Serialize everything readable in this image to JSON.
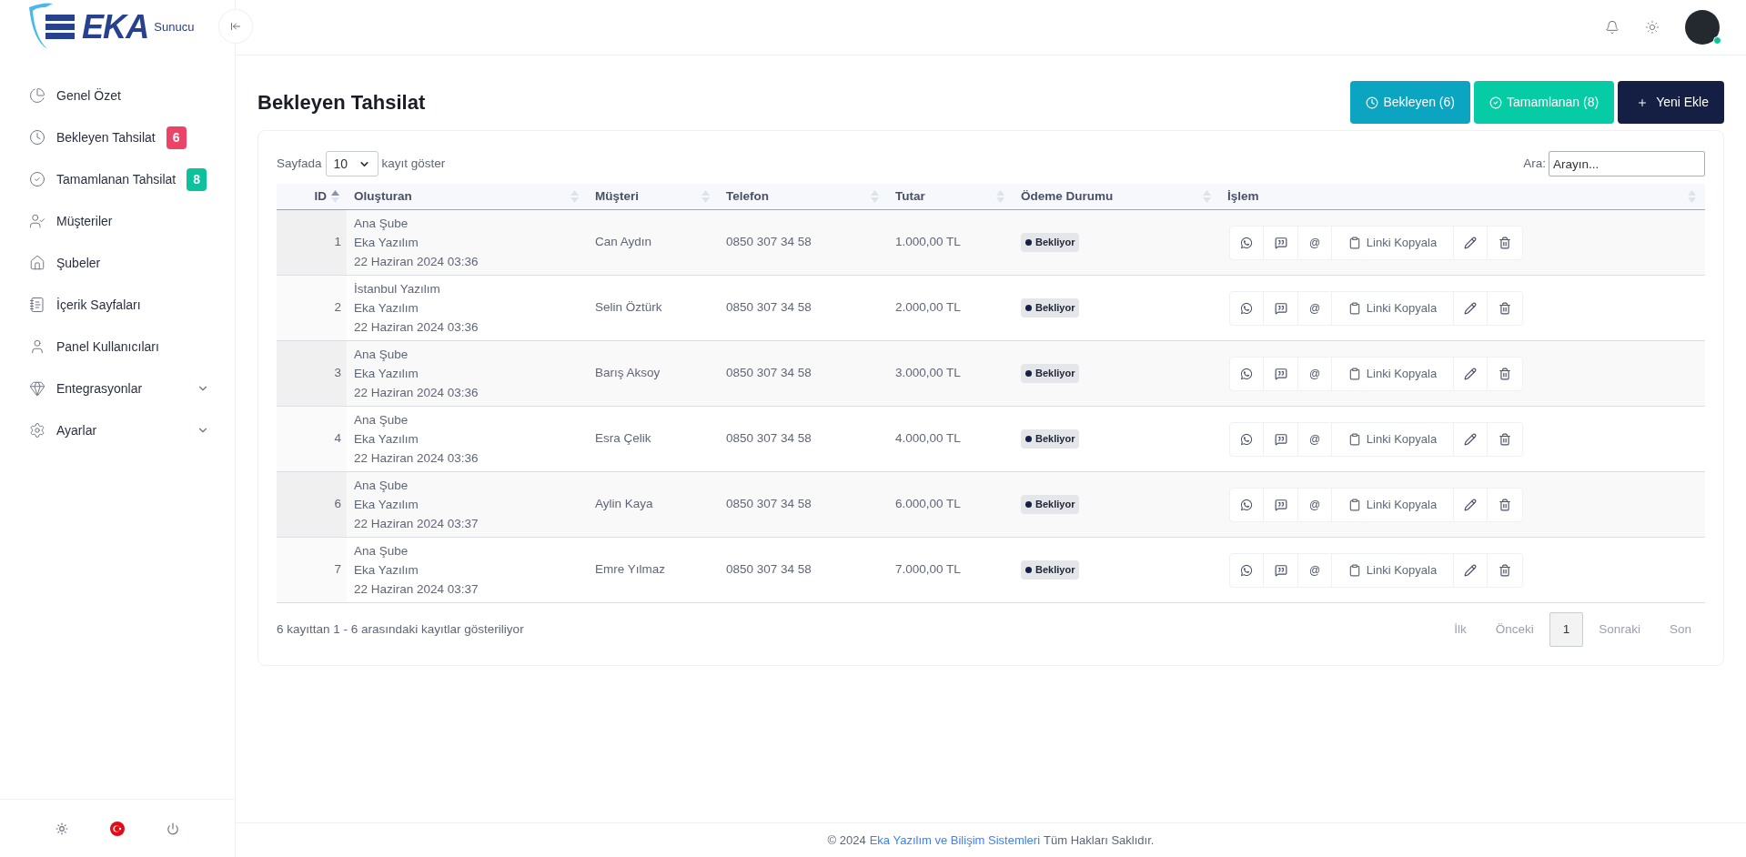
{
  "logo": {
    "brand": "EKA",
    "sub": "Sunucu"
  },
  "sidebar": {
    "items": [
      {
        "label": "Genel Özet",
        "expandable": false
      },
      {
        "label": "Bekleyen Tahsilat",
        "expandable": false,
        "badge": "6",
        "color": "#ec4468"
      },
      {
        "label": "Tamamlanan Tahsilat",
        "expandable": false,
        "badge": "8",
        "color": "#0bc29c"
      },
      {
        "label": "Müşteriler",
        "expandable": false
      },
      {
        "label": "Şubeler",
        "expandable": false
      },
      {
        "label": "İçerik Sayfaları",
        "expandable": false
      },
      {
        "label": "Panel Kullanıcıları",
        "expandable": false
      },
      {
        "label": "Entegrasyonlar",
        "expandable": true
      },
      {
        "label": "Ayarlar",
        "expandable": true
      }
    ]
  },
  "user": {
    "online": true
  },
  "page": {
    "title": "Bekleyen Tahsilat",
    "actions": [
      {
        "kind": "pending",
        "label": "Bekleyen (6)"
      },
      {
        "kind": "done",
        "label": "Tamamlanan (8)"
      },
      {
        "kind": "add",
        "label": "Yeni Ekle"
      }
    ]
  },
  "table": {
    "length_prefix": "Sayfada",
    "length_value": "10",
    "length_suffix": "kayıt göster",
    "search_label": "Ara:",
    "search_placeholder": "Arayın...",
    "columns": [
      {
        "label": "ID",
        "sorted": true
      },
      {
        "label": "Oluşturan",
        "sorted": false
      },
      {
        "label": "Müşteri",
        "sorted": false
      },
      {
        "label": "Telefon",
        "sorted": false
      },
      {
        "label": "Tutar",
        "sorted": false
      },
      {
        "label": "Ödeme Durumu",
        "sorted": false
      },
      {
        "label": "İşlem",
        "sorted": false
      }
    ],
    "rows": [
      {
        "id": "1",
        "creator": [
          "Ana Şube",
          "Eka Yazılım",
          "22 Haziran 2024 03:36"
        ],
        "customer": "Can Aydın",
        "phone": "0850 307 34 58",
        "amount": "1.000,00 TL",
        "status": "Bekliyor",
        "email": "@",
        "copy": "Linki Kopyala"
      },
      {
        "id": "2",
        "creator": [
          "İstanbul Yazılım",
          "Eka Yazılım",
          "22 Haziran 2024 03:36"
        ],
        "customer": "Selin Öztürk",
        "phone": "0850 307 34 58",
        "amount": "2.000,00 TL",
        "status": "Bekliyor",
        "email": "@",
        "copy": "Linki Kopyala"
      },
      {
        "id": "3",
        "creator": [
          "Ana Şube",
          "Eka Yazılım",
          "22 Haziran 2024 03:36"
        ],
        "customer": "Barış Aksoy",
        "phone": "0850 307 34 58",
        "amount": "3.000,00 TL",
        "status": "Bekliyor",
        "email": "@",
        "copy": "Linki Kopyala"
      },
      {
        "id": "4",
        "creator": [
          "Ana Şube",
          "Eka Yazılım",
          "22 Haziran 2024 03:36"
        ],
        "customer": "Esra Çelik",
        "phone": "0850 307 34 58",
        "amount": "4.000,00 TL",
        "status": "Bekliyor",
        "email": "@",
        "copy": "Linki Kopyala"
      },
      {
        "id": "6",
        "creator": [
          "Ana Şube",
          "Eka Yazılım",
          "22 Haziran 2024 03:37"
        ],
        "customer": "Aylin Kaya",
        "phone": "0850 307 34 58",
        "amount": "6.000,00 TL",
        "status": "Bekliyor",
        "email": "@",
        "copy": "Linki Kopyala"
      },
      {
        "id": "7",
        "creator": [
          "Ana Şube",
          "Eka Yazılım",
          "22 Haziran 2024 03:37"
        ],
        "customer": "Emre Yılmaz",
        "phone": "0850 307 34 58",
        "amount": "7.000,00 TL",
        "status": "Bekliyor",
        "email": "@",
        "copy": "Linki Kopyala"
      }
    ],
    "info": "6 kayıttan 1 - 6 arasındaki kayıtlar gösteriliyor",
    "pagination": [
      {
        "label": "İlk",
        "disabled": true,
        "selected": false
      },
      {
        "label": "Önceki",
        "disabled": true,
        "selected": false
      },
      {
        "label": "1",
        "disabled": false,
        "selected": true
      },
      {
        "label": "Sonraki",
        "disabled": true,
        "selected": false
      },
      {
        "label": "Son",
        "disabled": true,
        "selected": false
      }
    ]
  },
  "footer": {
    "prefix": "© 2024",
    "link": "Eka Yazılım ve Bilişim Sistemleri",
    "suffix": "Tüm Hakları Saklıdır."
  }
}
